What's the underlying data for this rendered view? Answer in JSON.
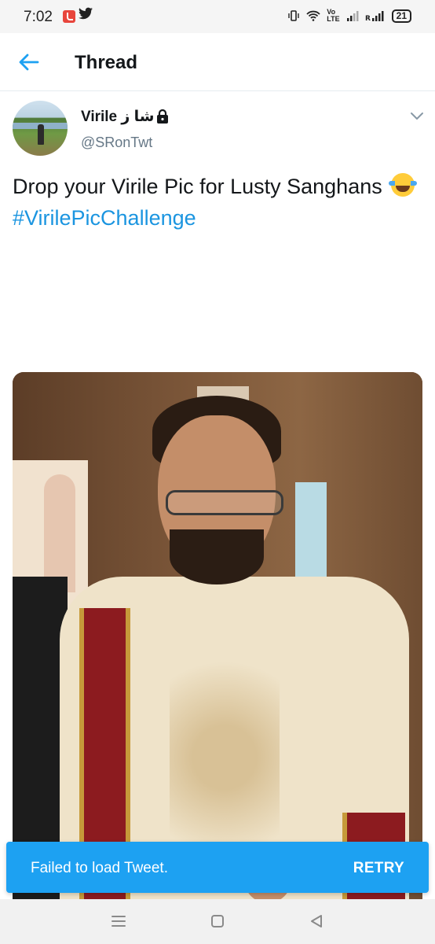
{
  "status_bar": {
    "time": "7:02",
    "signal_labels": {
      "volte": "Vo\nLTE",
      "roaming": "R"
    },
    "battery": "21"
  },
  "topbar": {
    "title": "Thread",
    "back_icon": "arrow-left-icon"
  },
  "tweet": {
    "display_name": "Virile شا ز",
    "handle": "@SRonTwt",
    "protected_icon": "lock-icon",
    "text": "Drop your Virile Pic for Lusty Sanghans",
    "emoji": "face-with-tears-of-joy",
    "hashtag": "#VirilePicChallenge",
    "menu_icon": "chevron-down-icon"
  },
  "toast": {
    "message": "Failed to load Tweet.",
    "action": "RETRY",
    "color": "#1da1f2"
  },
  "colors": {
    "accent": "#1da1f2",
    "link": "#1b95e0",
    "text": "#14171a",
    "muted": "#657786"
  }
}
